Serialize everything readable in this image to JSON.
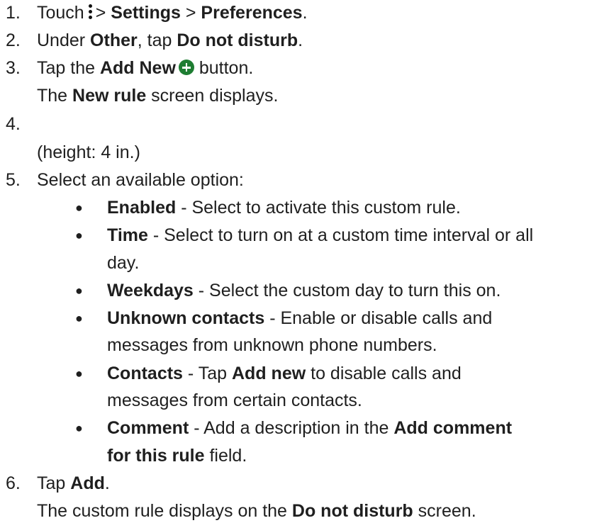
{
  "steps": [
    {
      "num": "1.",
      "parts": {
        "a": "Touch",
        "b": ">",
        "c": "Settings",
        "d": ">",
        "e": "Preferences",
        "f": "."
      }
    },
    {
      "num": "2.",
      "parts": {
        "a": "Under ",
        "b": "Other",
        "c": ", tap ",
        "d": "Do not disturb",
        "e": "."
      }
    },
    {
      "num": "3.",
      "parts": {
        "a": "Tap the ",
        "b": "Add New",
        "c": " button."
      }
    },
    {
      "num": "4.",
      "parts": {}
    },
    {
      "num": "5.",
      "parts": {
        "a": "Select an available option:"
      }
    },
    {
      "num": "6.",
      "parts": {
        "a": "Tap ",
        "b": "Add",
        "c": "."
      }
    }
  ],
  "step3_note": {
    "a": "The ",
    "b": "New rule",
    "c": " screen displays."
  },
  "step4_note": "(height: 4 in.)",
  "options": [
    {
      "name": "Enabled",
      "desc": " - Select to activate this custom rule."
    },
    {
      "name": "Time",
      "desc": " - Select to turn on at a custom time interval or all",
      "desc2": "day."
    },
    {
      "name": "Weekdays",
      "desc": " - Select the custom day to turn this on."
    },
    {
      "name": "Unknown contacts",
      "desc": " - Enable or disable calls and",
      "desc2": "messages from unknown phone numbers."
    },
    {
      "name": "Contacts",
      "desc_a": " - Tap ",
      "desc_b": "Add new",
      "desc_c": " to disable calls and",
      "desc2": "messages from certain contacts."
    },
    {
      "name": "Comment",
      "desc_a": " - Add a description in the ",
      "desc_b": "Add comment",
      "desc2_b": "for this rule",
      "desc2_c": " field."
    }
  ],
  "step6_note": {
    "a": "The custom rule displays on the ",
    "b": "Do not disturb",
    "c": " screen."
  },
  "icons": {
    "menu": "kebab-menu-icon",
    "add": "add-new-plus-icon",
    "add_color": "#1e7d32"
  }
}
